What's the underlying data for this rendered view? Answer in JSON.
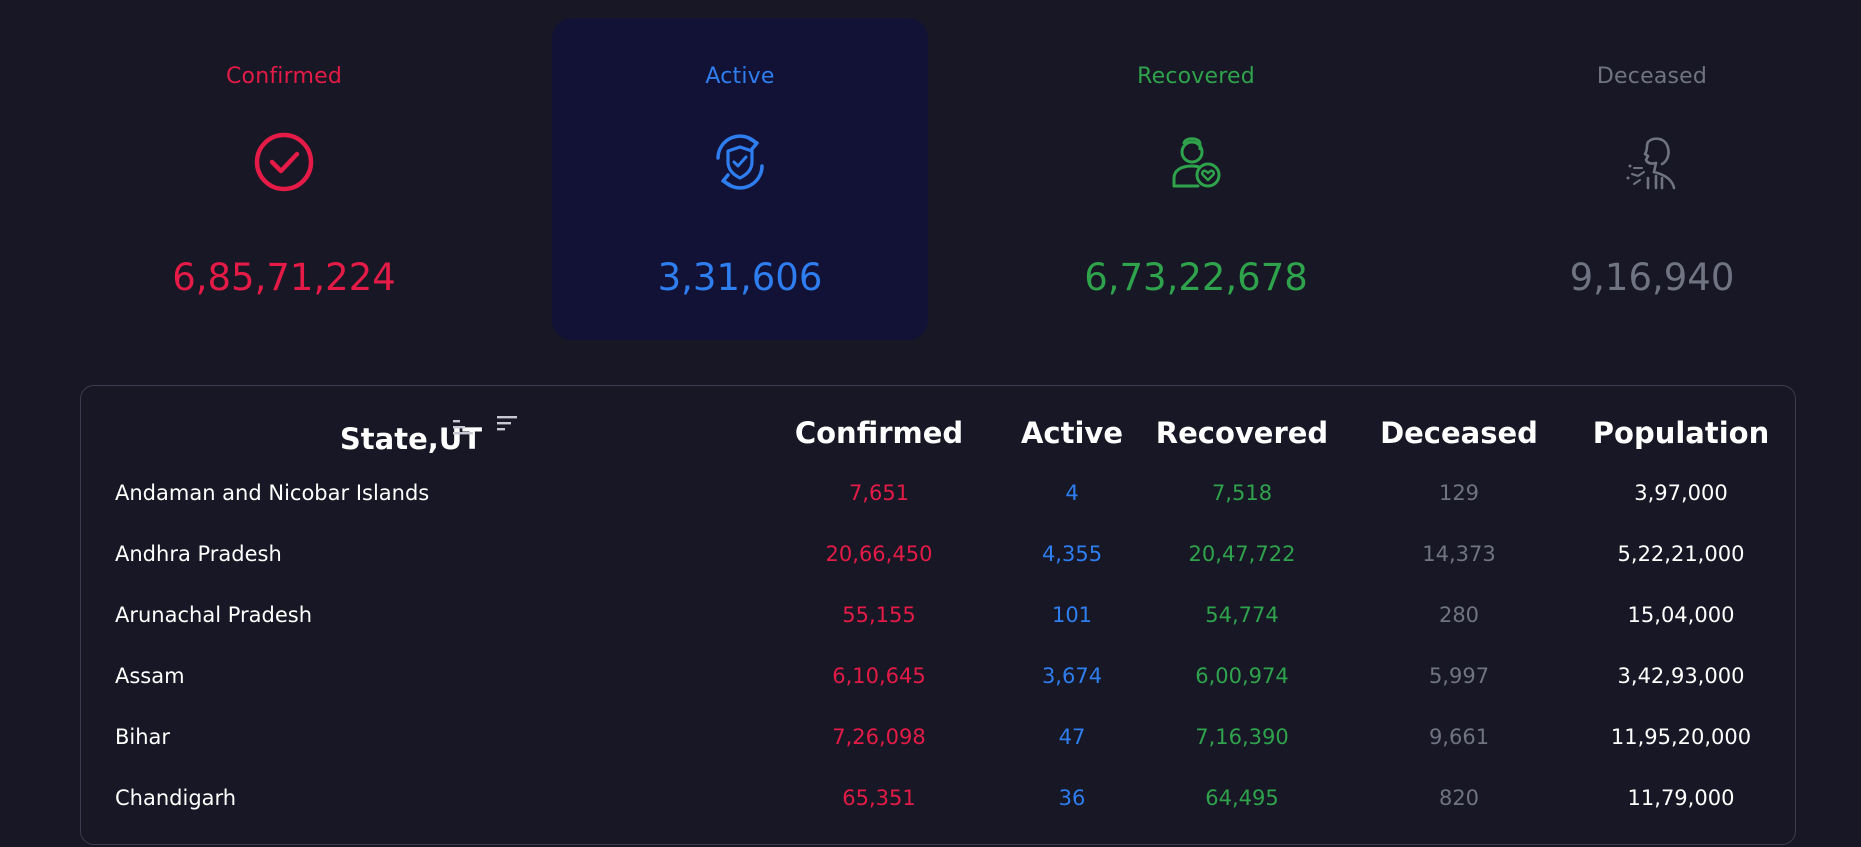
{
  "summary": {
    "confirmed": {
      "label": "Confirmed",
      "value": "6,85,71,224",
      "icon": "check-circle-icon"
    },
    "active": {
      "label": "Active",
      "value": "3,31,606",
      "icon": "shield-refresh-icon"
    },
    "recovered": {
      "label": "Recovered",
      "value": "6,73,22,678",
      "icon": "person-heart-icon"
    },
    "deceased": {
      "label": "Deceased",
      "value": "9,16,940",
      "icon": "person-sick-icon"
    }
  },
  "table": {
    "headers": {
      "state": "State,UT",
      "confirmed": "Confirmed",
      "active": "Active",
      "recovered": "Recovered",
      "deceased": "Deceased",
      "population": "Population"
    },
    "rows": [
      {
        "state": "Andaman and Nicobar Islands",
        "confirmed": "7,651",
        "active": "4",
        "recovered": "7,518",
        "deceased": "129",
        "population": "3,97,000"
      },
      {
        "state": "Andhra Pradesh",
        "confirmed": "20,66,450",
        "active": "4,355",
        "recovered": "20,47,722",
        "deceased": "14,373",
        "population": "5,22,21,000"
      },
      {
        "state": "Arunachal Pradesh",
        "confirmed": "55,155",
        "active": "101",
        "recovered": "54,774",
        "deceased": "280",
        "population": "15,04,000"
      },
      {
        "state": "Assam",
        "confirmed": "6,10,645",
        "active": "3,674",
        "recovered": "6,00,974",
        "deceased": "5,997",
        "population": "3,42,93,000"
      },
      {
        "state": "Bihar",
        "confirmed": "7,26,098",
        "active": "47",
        "recovered": "7,16,390",
        "deceased": "9,661",
        "population": "11,95,20,000"
      },
      {
        "state": "Chandigarh",
        "confirmed": "65,351",
        "active": "36",
        "recovered": "64,495",
        "deceased": "820",
        "population": "11,79,000"
      }
    ]
  },
  "colors": {
    "background": "#171725",
    "selected_card": "#121236",
    "confirmed": "#e31b46",
    "active": "#2e7ef0",
    "recovered": "#2fa34c",
    "deceased": "#707482"
  }
}
